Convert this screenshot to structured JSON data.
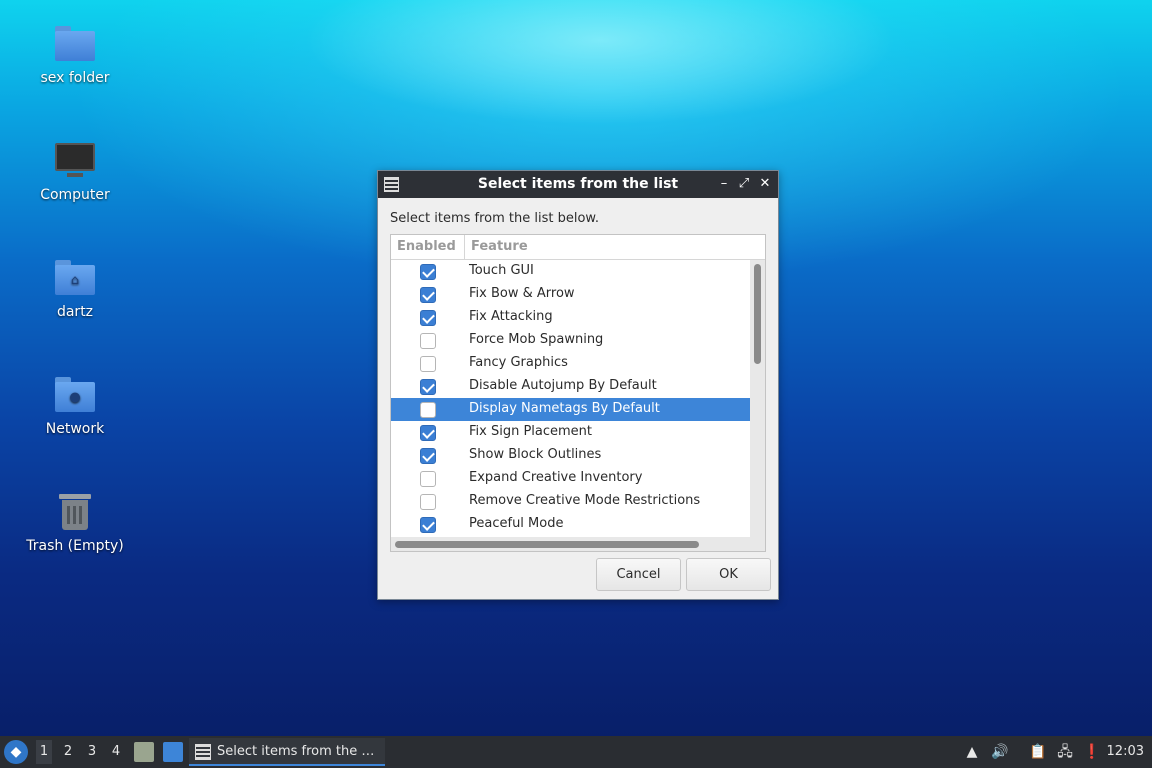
{
  "desktop": {
    "icons": [
      {
        "label": "sex folder",
        "icon": "folder-icon"
      },
      {
        "label": "Computer",
        "icon": "computer-icon"
      },
      {
        "label": "dartz",
        "icon": "home-folder-icon"
      },
      {
        "label": "Network",
        "icon": "network-folder-icon"
      },
      {
        "label": "Trash (Empty)",
        "icon": "trash-icon"
      }
    ]
  },
  "dialog": {
    "title": "Select items from the list",
    "prompt": "Select items from the list below.",
    "columns": {
      "enabled": "Enabled",
      "feature": "Feature"
    },
    "items": [
      {
        "feature": "Touch GUI",
        "enabled": true
      },
      {
        "feature": "Fix Bow & Arrow",
        "enabled": true
      },
      {
        "feature": "Fix Attacking",
        "enabled": true
      },
      {
        "feature": "Force Mob Spawning",
        "enabled": false
      },
      {
        "feature": "Fancy Graphics",
        "enabled": false
      },
      {
        "feature": "Disable Autojump By Default",
        "enabled": true
      },
      {
        "feature": "Display Nametags By Default",
        "enabled": false,
        "selected": true
      },
      {
        "feature": "Fix Sign Placement",
        "enabled": true
      },
      {
        "feature": "Show Block Outlines",
        "enabled": true
      },
      {
        "feature": "Expand Creative Inventory",
        "enabled": false
      },
      {
        "feature": "Remove Creative Mode Restrictions",
        "enabled": false
      },
      {
        "feature": "Peaceful Mode",
        "enabled": true
      }
    ],
    "buttons": {
      "cancel": "Cancel",
      "ok": "OK"
    },
    "controls": {
      "minimize": "–",
      "maximize": "⤢",
      "close": "✕"
    }
  },
  "taskbar": {
    "workspaces": [
      "1",
      "2",
      "3",
      "4"
    ],
    "active_workspace": "1",
    "task_label": "Select items from the …",
    "clock": "12:03"
  },
  "colors": {
    "selection": "#3d85d8",
    "checkbox_checked": "#3b7fd4",
    "titlebar": "#2d3036",
    "taskbar": "#2a2d32"
  }
}
